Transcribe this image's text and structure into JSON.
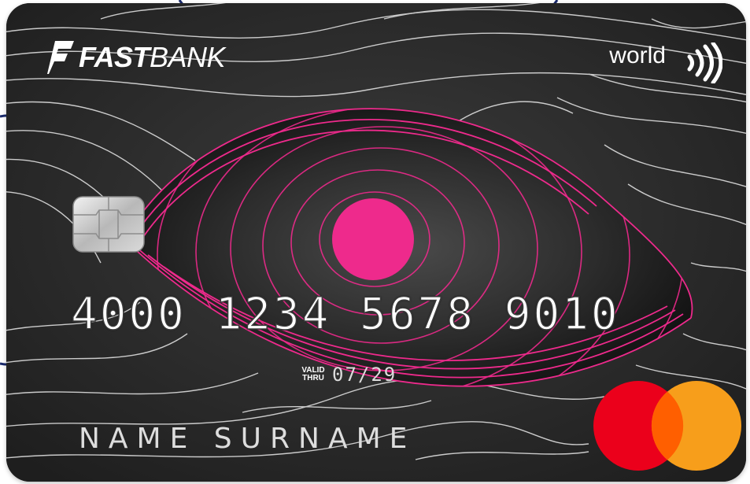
{
  "card": {
    "issuer": {
      "name_bold": "FAST",
      "name_light": "BANK"
    },
    "tier": "world",
    "number": "4000 1234 5678 9010",
    "valid_label_line1": "VALID",
    "valid_label_line2": "THRU",
    "expiry": "07/29",
    "holder_name": "NAME SURNAME",
    "network": "mastercard",
    "icons": {
      "contactless": "contactless-icon",
      "chip": "emv-chip-icon",
      "brand_mark": "fastbank-logo-mark"
    }
  },
  "colors": {
    "card_background": "#2a2a2a",
    "accent_pink": "#ee2a8c",
    "mastercard_red": "#eb001b",
    "mastercard_orange": "#f79e1b",
    "mastercard_overlap": "#ff5f00",
    "border_navy": "#1a2a6c"
  }
}
